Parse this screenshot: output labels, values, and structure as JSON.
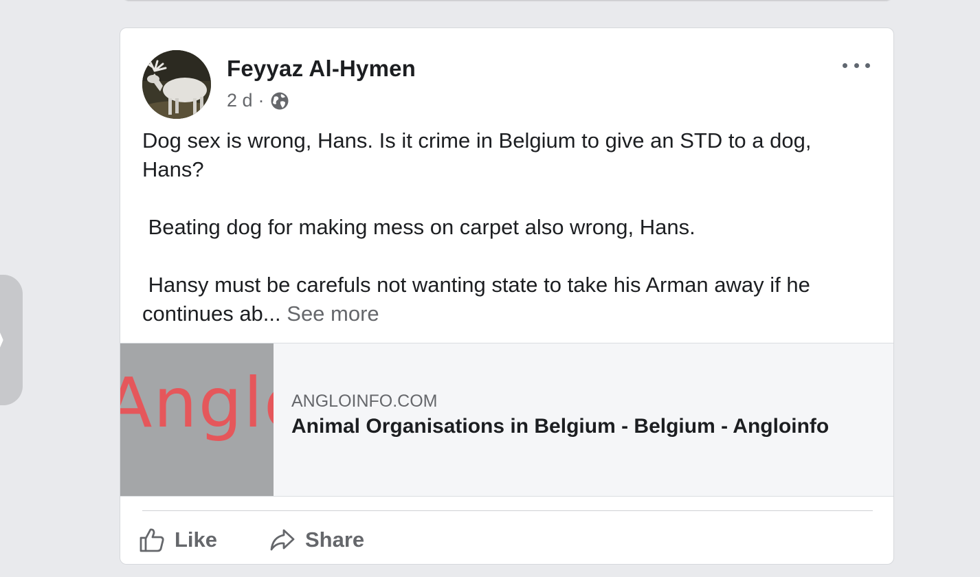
{
  "post": {
    "author": "Feyyaz Al-Hymen",
    "timestamp": "2 d",
    "separator": "·",
    "audience_icon": "globe-icon",
    "avatar_icon": "moose-avatar",
    "more_icon": "more-options-icon",
    "text": {
      "paragraph_1": "Dog sex is wrong, Hans. Is it crime in Belgium to give an STD to a dog, Hans?",
      "paragraph_2": " Beating dog for making mess on carpet also wrong, Hans.",
      "paragraph_3": " Hansy must be carefuls not wanting state to take his Arman away if he continues ab...",
      "see_more": "See more"
    }
  },
  "link_preview": {
    "thumbnail_text": "Anglo",
    "domain": "ANGLOINFO.COM",
    "title": "Animal Organisations in Belgium - Belgium - Angloinfo"
  },
  "actions": {
    "like_label": "Like",
    "share_label": "Share"
  },
  "colors": {
    "background": "#e9eaed",
    "card": "#ffffff",
    "secondary_text": "#65676b",
    "primary_text": "#1c1e21",
    "thumb_bg": "#a4a6a8",
    "thumb_text": "#e5575b"
  }
}
